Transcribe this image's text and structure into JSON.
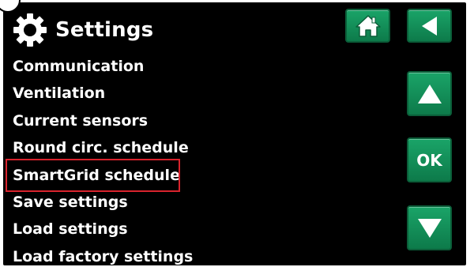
{
  "header": {
    "title": "Settings",
    "icon": "gear-icon"
  },
  "menu": {
    "items": [
      {
        "label": "Communication"
      },
      {
        "label": "Ventilation"
      },
      {
        "label": "Current sensors"
      },
      {
        "label": "Round circ. schedule"
      },
      {
        "label": "SmartGrid schedule",
        "highlighted": true
      },
      {
        "label": "Save settings"
      },
      {
        "label": "Load settings"
      },
      {
        "label": "Load factory settings"
      }
    ]
  },
  "buttons": {
    "home": {
      "icon": "home-icon"
    },
    "back": {
      "icon": "back-arrow-icon"
    },
    "up": {
      "icon": "up-arrow-icon"
    },
    "ok": {
      "label": "OK"
    },
    "down": {
      "icon": "down-arrow-icon"
    }
  },
  "colors": {
    "background": "#000000",
    "text": "#ffffff",
    "button_green": "#1aa468",
    "highlight_red": "#d9232d"
  }
}
